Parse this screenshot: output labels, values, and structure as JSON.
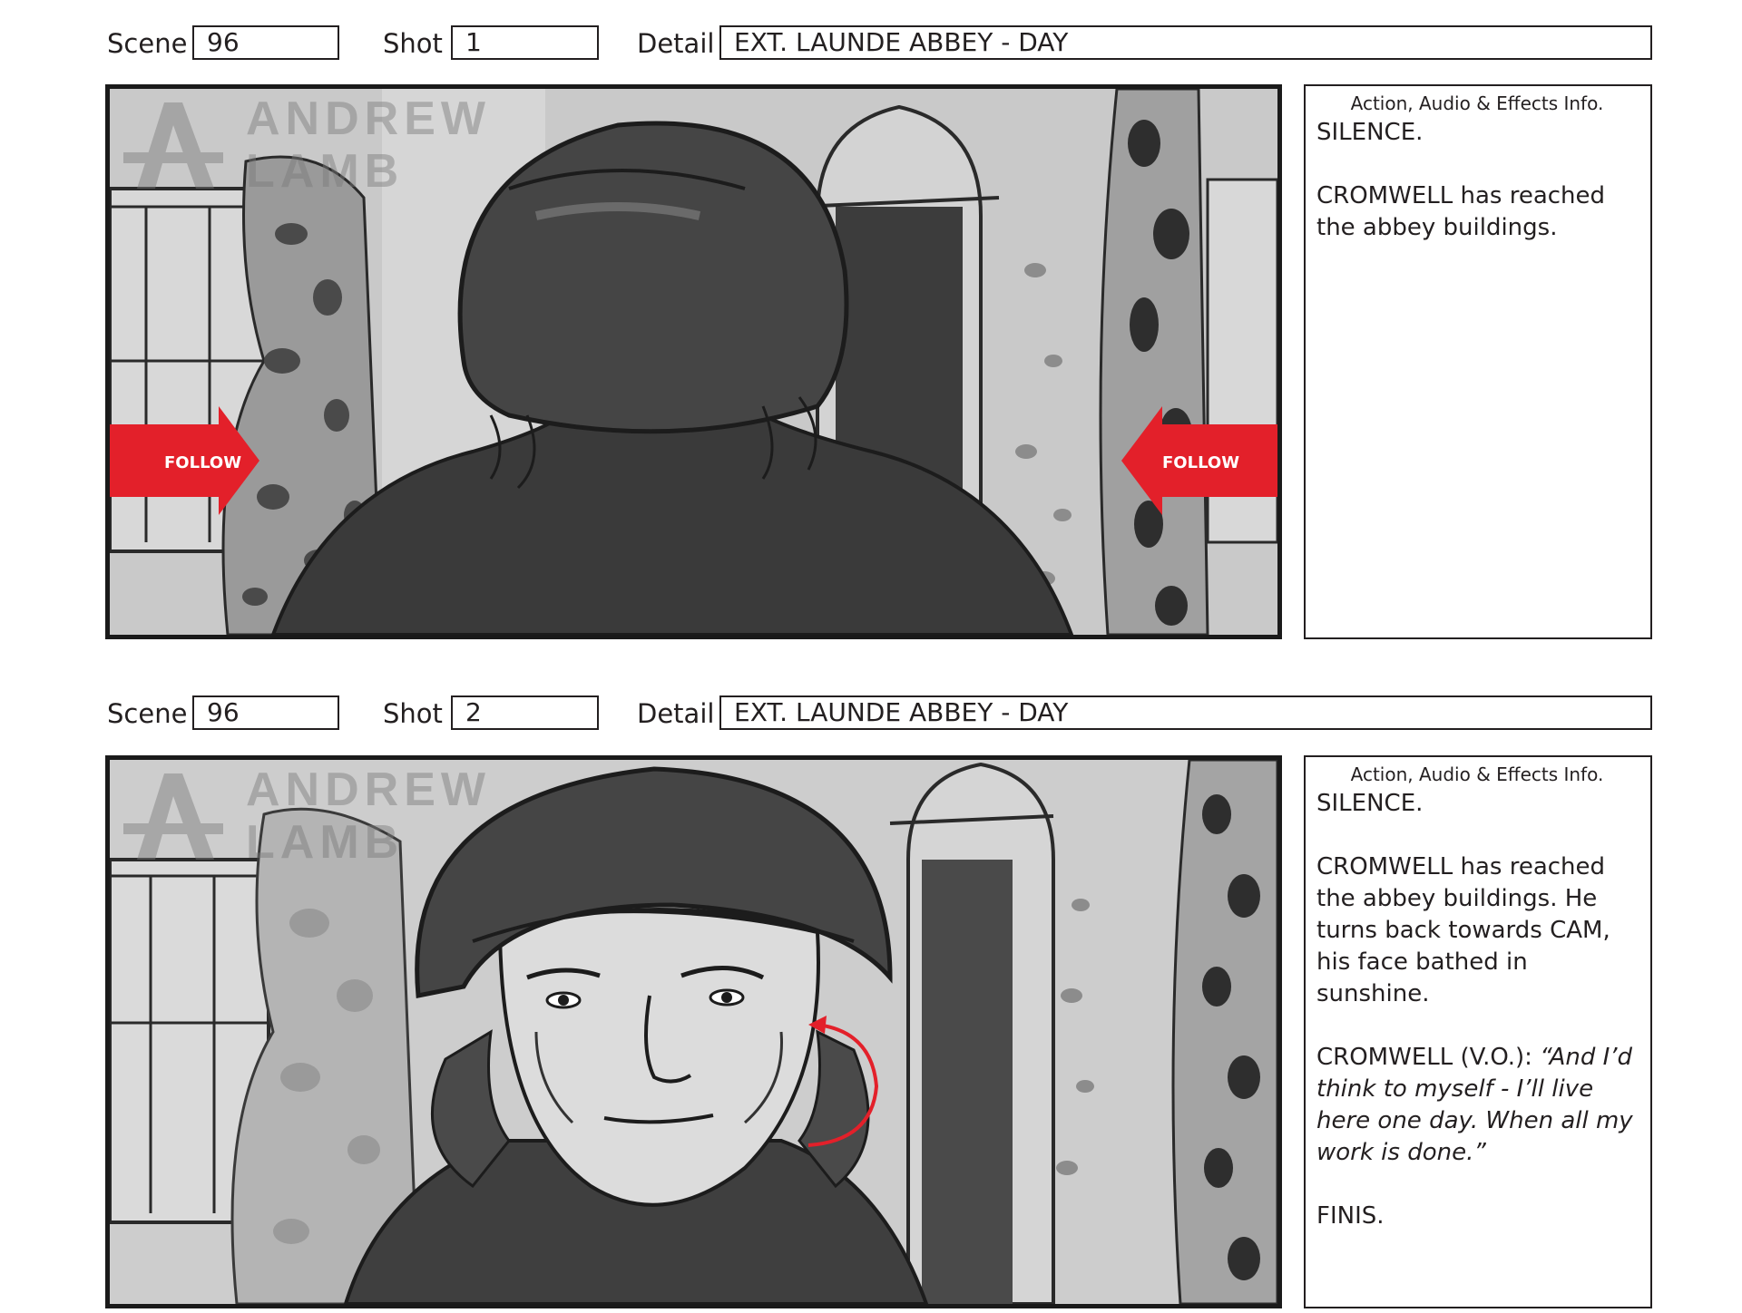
{
  "labels": {
    "scene": "Scene",
    "shot": "Shot",
    "detail": "Detail",
    "notes_header": "Action, Audio & Effects Info."
  },
  "watermark": {
    "line1": "ANDREW",
    "line2": "LAMB"
  },
  "colors": {
    "accent_red": "#e3202a",
    "ink": "#231f20"
  },
  "panels": [
    {
      "scene": "96",
      "shot": "1",
      "detail": "EXT. LAUNDE ABBEY - DAY",
      "arrow_label": "FOLLOW",
      "notes": {
        "p1": "SILENCE.",
        "p2": "CROMWELL has reached the abbey buildings."
      }
    },
    {
      "scene": "96",
      "shot": "2",
      "detail": "EXT. LAUNDE ABBEY - DAY",
      "notes": {
        "p1": "SILENCE.",
        "p2": "CROMWELL has reached the abbey buildings. He turns back towards CAM, his face bathed in sunshine.",
        "p3_speaker": "CROMWELL (V.O.): ",
        "p3_quote": "“And I’d think to myself - I’ll live here one day. When all my work is done.”",
        "p4": "FINIS."
      }
    }
  ]
}
